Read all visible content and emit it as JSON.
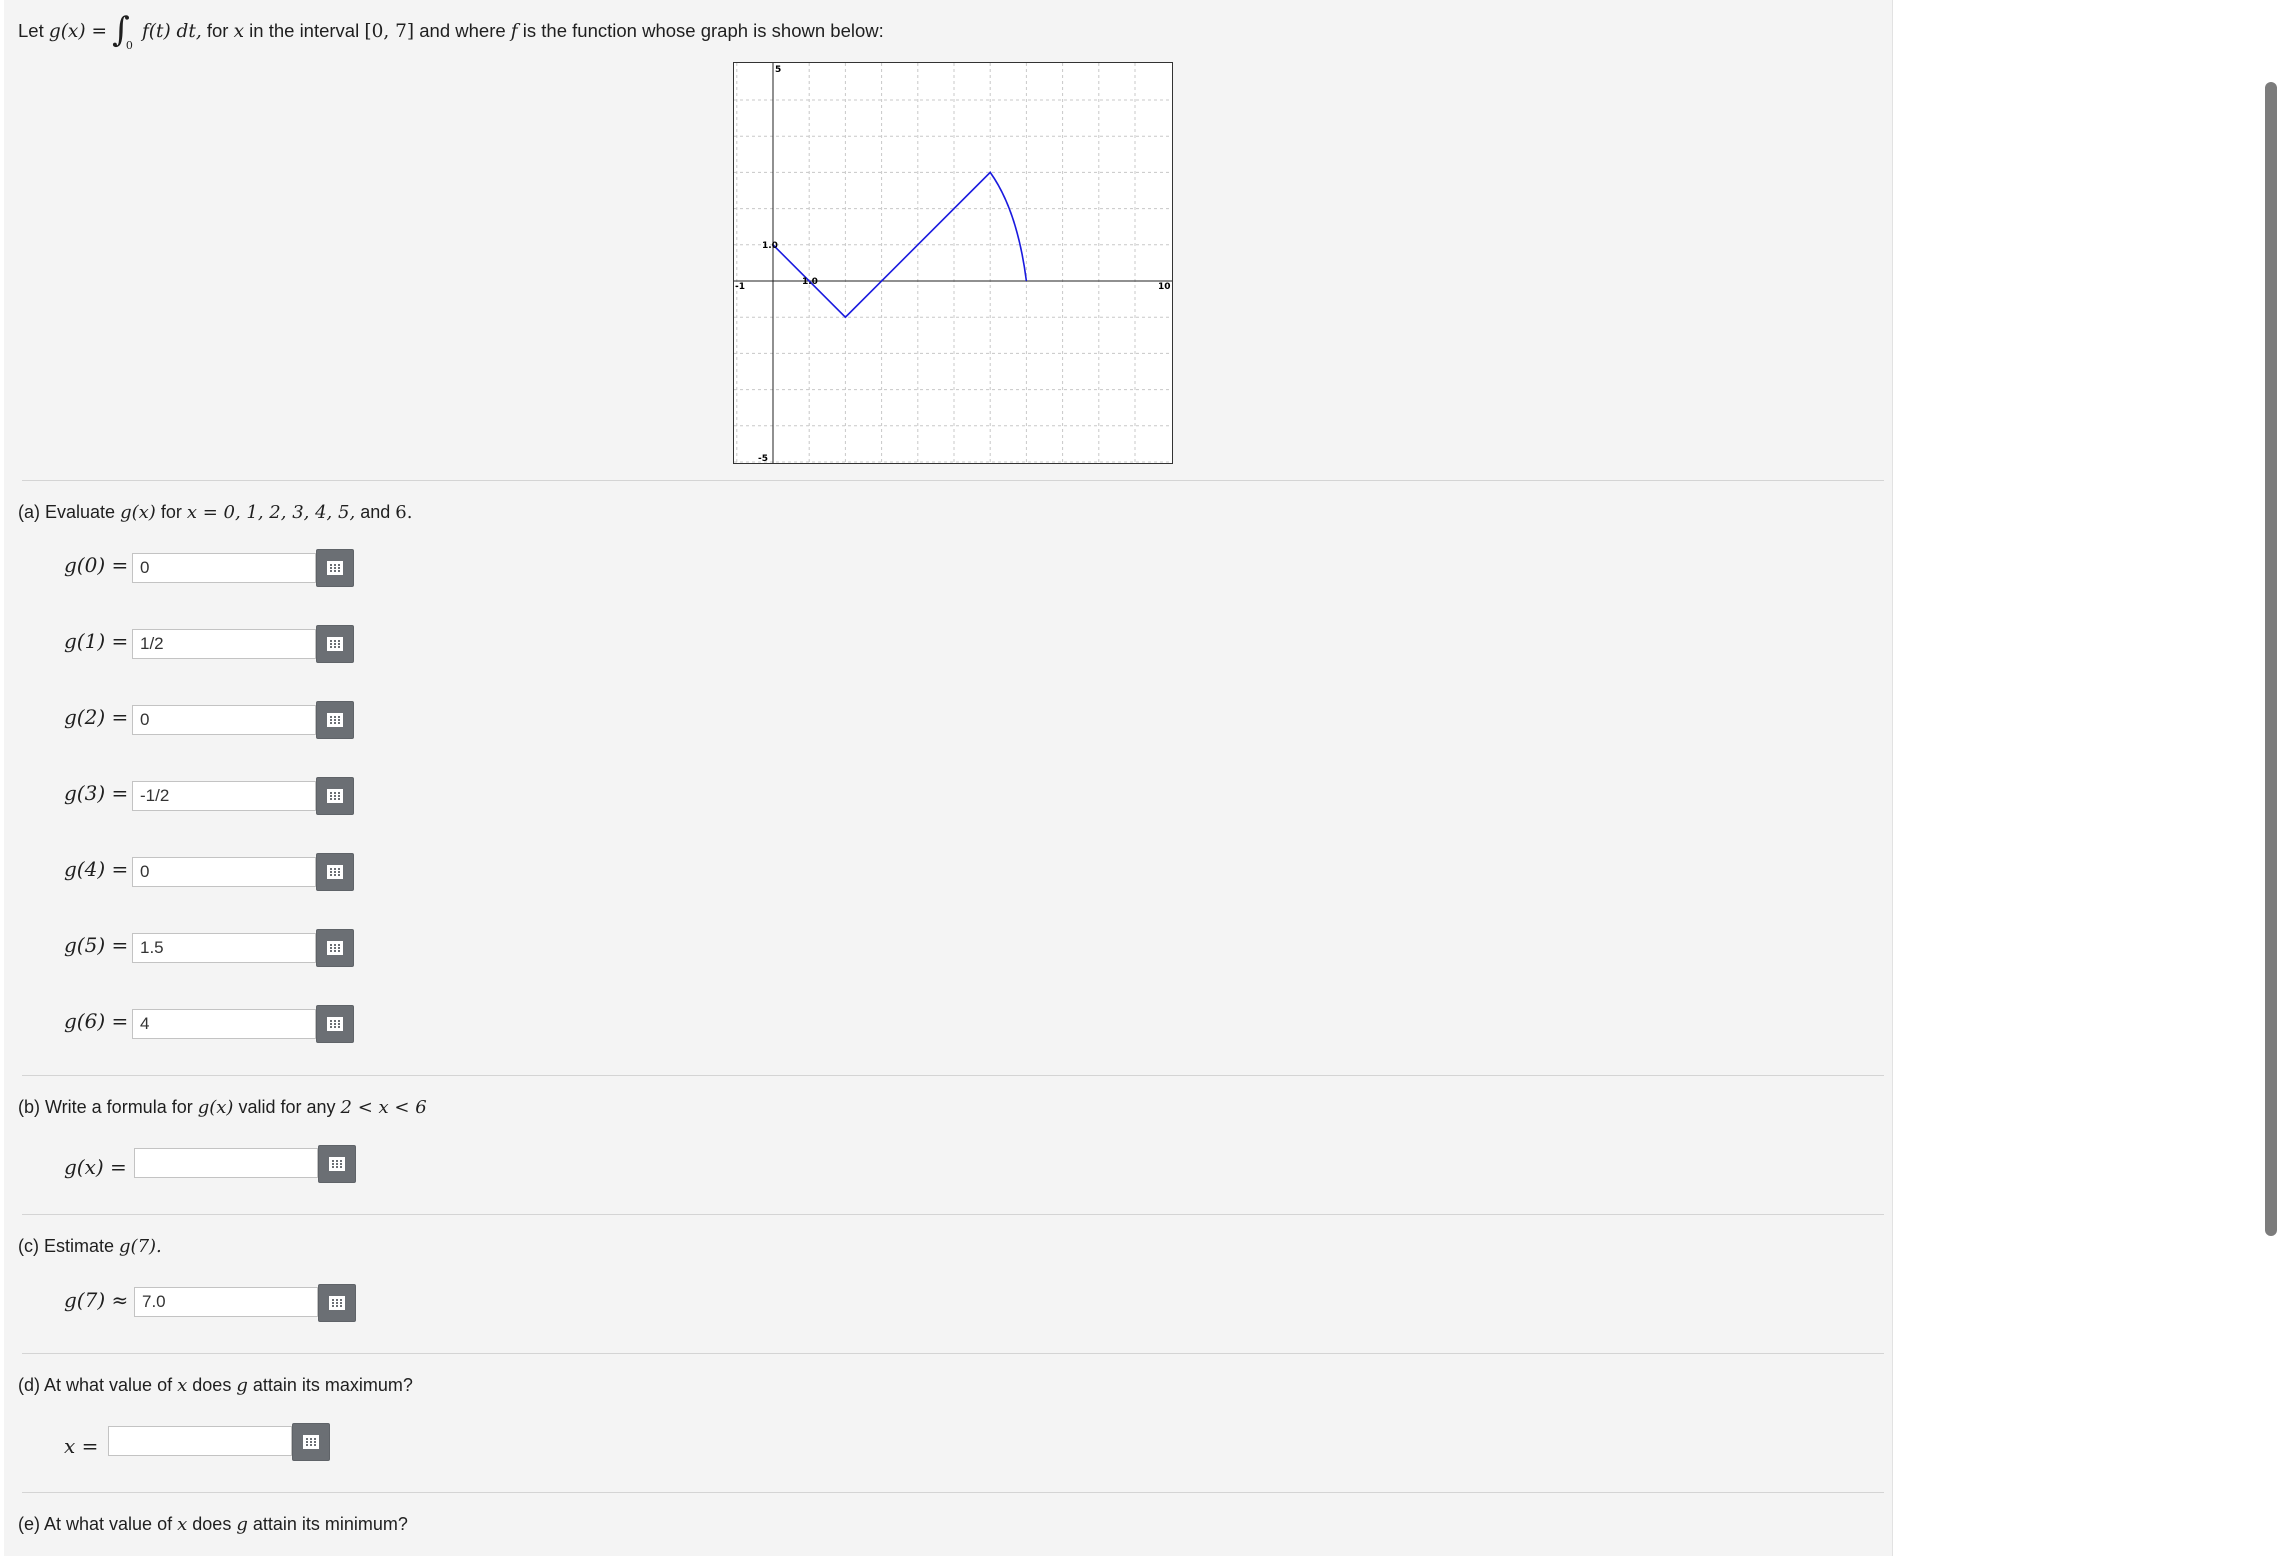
{
  "intro": {
    "let": "Let",
    "g_of_x": "g(x) =",
    "integral_sign": "∫",
    "lower_limit": "0",
    "integrand": "f(t) dt,",
    "for_text": "for",
    "x_var": "x",
    "in_interval_text": "in the interval",
    "interval": "[0, 7]",
    "and_where_text": "and where",
    "f_var": "f",
    "rest_text": "is the function whose graph is shown below:"
  },
  "graph": {
    "tick_labels": {
      "y_top": "5",
      "y_bottom": "-5",
      "x_left": "-1",
      "x_right": "10",
      "one_y": "1.0",
      "one_x": "1.0"
    },
    "line_color": "#1a1adf"
  },
  "chart_data": {
    "type": "line",
    "xlim": [
      -1,
      10
    ],
    "ylim": [
      -5,
      6
    ],
    "grid": true,
    "series": [
      {
        "x": [
          0,
          2,
          6,
          7
        ],
        "y": [
          1,
          -1,
          3,
          0
        ],
        "curved_last_segment": true
      }
    ]
  },
  "part_a": {
    "prefix": "(a) Evaluate",
    "gx": "g(x)",
    "for_text": "for",
    "values_text": "x = 0, 1, 2, 3, 4, 5,",
    "and_text": "and",
    "six": "6.",
    "rows": [
      {
        "label": "g(0) =",
        "value": "0"
      },
      {
        "label": "g(1) =",
        "value": "1/2"
      },
      {
        "label": "g(2) =",
        "value": "0"
      },
      {
        "label": "g(3) =",
        "value": "-1/2"
      },
      {
        "label": "g(4) =",
        "value": "0"
      },
      {
        "label": "g(5) =",
        "value": "1.5"
      },
      {
        "label": "g(6) =",
        "value": "4"
      }
    ]
  },
  "part_b": {
    "prefix": "(b) Write a formula for",
    "gx": "g(x)",
    "suffix": "valid for any",
    "range": "2 < x < 6",
    "label": "g(x) =",
    "value": ""
  },
  "part_c": {
    "prefix": "(c) Estimate",
    "g7": "g(7).",
    "label": "g(7) ≈",
    "value": "7.0"
  },
  "part_d": {
    "prefix": "(d) At what value of",
    "x": "x",
    "middle": "does",
    "g": "g",
    "suffix": "attain its maximum?",
    "label": "x =",
    "value": ""
  },
  "part_e": {
    "prefix": "(e) At what value of",
    "x": "x",
    "middle": "does",
    "g": "g",
    "suffix": "attain its minimum?"
  }
}
